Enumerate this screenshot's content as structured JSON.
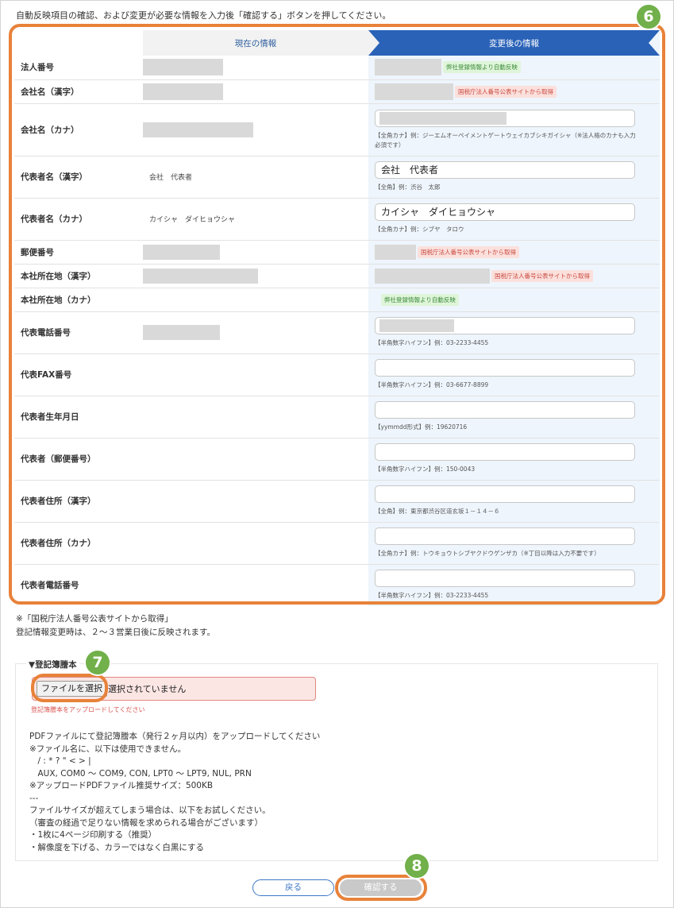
{
  "intro": "自動反映項目の確認、および変更が必要な情報を入力後「確認する」ボタンを押してください。",
  "header": {
    "current": "現在の情報",
    "new": "変更後の情報"
  },
  "tags": {
    "auto": "弊社登録情報より自動反映",
    "nta": "国税庁法人番号公表サイトから取得"
  },
  "rows": {
    "corp_no": {
      "label": "法人番号"
    },
    "name_kanji": {
      "label": "会社名（漢字）"
    },
    "name_kana": {
      "label": "会社名（カナ）",
      "hint": "【全角カナ】例：ジーエムオーペイメントゲートウェイカブシキガイシャ（※法人格のカナも入力必須です）"
    },
    "rep_kanji": {
      "label": "代表者名（漢字）",
      "current": "会社　代表者",
      "value": "会社　代表者",
      "hint": "【全角】例：渋谷　太郎"
    },
    "rep_kana": {
      "label": "代表者名（カナ）",
      "current": "カイシャ　ダイヒョウシャ",
      "value": "カイシャ　ダイヒョウシャ",
      "hint": "【全角カナ】例：シブヤ　タロウ"
    },
    "zip": {
      "label": "郵便番号"
    },
    "addr_kanji": {
      "label": "本社所在地（漢字）"
    },
    "addr_kana": {
      "label": "本社所在地（カナ）"
    },
    "tel": {
      "label": "代表電話番号",
      "hint": "【半角数字ハイフン】例：03-2233-4455"
    },
    "fax": {
      "label": "代表FAX番号",
      "hint": "【半角数字ハイフン】例：03-6677-8899"
    },
    "birth": {
      "label": "代表者生年月日",
      "hint": "【yymmdd形式】例：19620716"
    },
    "rep_zip": {
      "label": "代表者（郵便番号）",
      "hint": "【半角数字ハイフン】例：150-0043"
    },
    "rep_addr_kanji": {
      "label": "代表者住所（漢字）",
      "hint": "【全角】例：東京都渋谷区道玄坂１－１４－６"
    },
    "rep_addr_kana": {
      "label": "代表者住所（カナ）",
      "hint": "【全角カナ】例：トウキョウトシブヤクドウゲンザカ（※丁目以降は入力不要です）"
    },
    "rep_tel": {
      "label": "代表者電話番号",
      "hint": "【半角数字ハイフン】例：03-2233-4455"
    }
  },
  "badges": {
    "b6": "6",
    "b7": "7",
    "b8": "8"
  },
  "note": {
    "line1": "※「国税庁法人番号公表サイトから取得」",
    "line2": "登記情報変更時は、２～３営業日後に反映されます。"
  },
  "register": {
    "title": "▼登記簿謄本",
    "file_button": "ファイルを選択",
    "file_status": "選択されていません",
    "error": "登記簿謄本をアップロードしてください",
    "instructions": "PDFファイルにて登記簿謄本（発行２ヶ月以内）をアップロードしてください\n※ファイル名に、以下は使用できません。\n　/ : * ? \" < > |\n　AUX, COM0 ～ COM9, CON, LPT0 ～ LPT9, NUL, PRN\n※アップロードPDFファイル推奨サイズ：500KB\n---\nファイルサイズが超えてしまう場合は、以下をお試しください。\n（審査の経過で足りない情報を求められる場合がございます）\n・1枚に4ページ印刷する（推奨）\n・解像度を下げる、カラーではなく白黒にする"
  },
  "buttons": {
    "back": "戻る",
    "confirm": "確認する"
  },
  "colors": {
    "accent": "#2a62b8",
    "highlight": "#e8823a",
    "badge": "#71b04a",
    "error": "#d9534f"
  }
}
